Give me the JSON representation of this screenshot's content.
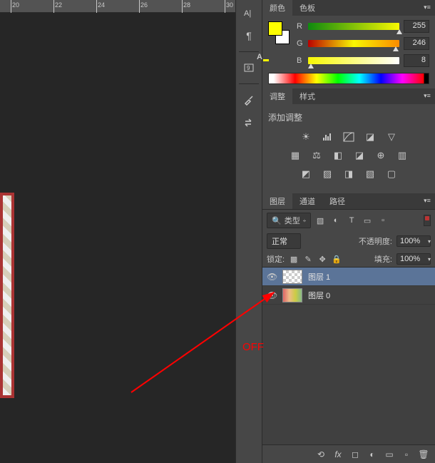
{
  "ruler": {
    "ticks": [
      20,
      22,
      24,
      26,
      28,
      30
    ]
  },
  "colorPanel": {
    "tabs": {
      "color": "颜色",
      "swatches": "色板"
    },
    "fg": "#FFFF00",
    "channels": {
      "r": {
        "label": "R",
        "value": "255"
      },
      "g": {
        "label": "G",
        "value": "246"
      },
      "b": {
        "label": "B",
        "value": "8"
      }
    }
  },
  "adjustPanel": {
    "tabs": {
      "adjust": "调整",
      "styles": "样式"
    },
    "title": "添加调整"
  },
  "layersPanel": {
    "tabs": {
      "layers": "图层",
      "channels": "通道",
      "paths": "路径"
    },
    "kind": "类型",
    "blend": "正常",
    "opacityLabel": "不透明度:",
    "opacity": "100%",
    "lockLabel": "锁定:",
    "fillLabel": "填充:",
    "fill": "100%",
    "layers": [
      {
        "name": "图层 1"
      },
      {
        "name": "图层 0"
      }
    ]
  },
  "annotation": {
    "off": "OFF"
  }
}
